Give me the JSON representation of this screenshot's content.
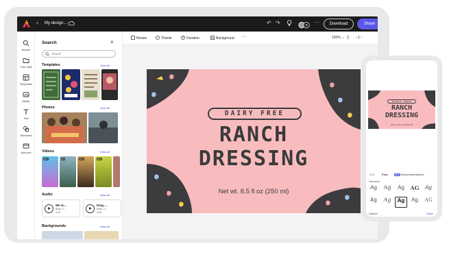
{
  "topbar": {
    "doc_title": "My design...",
    "download_label": "Download",
    "share_label": "Share"
  },
  "rail": [
    {
      "label": "Search",
      "icon": "search-icon"
    },
    {
      "label": "Your stuff",
      "icon": "folder-icon"
    },
    {
      "label": "Templates",
      "icon": "templates-icon"
    },
    {
      "label": "Media",
      "icon": "media-icon"
    },
    {
      "label": "Text",
      "icon": "text-icon"
    },
    {
      "label": "Elements",
      "icon": "elements-icon"
    },
    {
      "label": "Add-ons",
      "icon": "add-ons-icon"
    }
  ],
  "panel": {
    "title": "Search",
    "search_placeholder": "Search",
    "sections": {
      "templates": "Templates",
      "photos": "Photos",
      "videos": "Videos",
      "audio": "Audio",
      "backgrounds": "Backgrounds"
    },
    "view_all": "View all",
    "videos": [
      {
        "duration": "24 s"
      },
      {
        "duration": "9 s"
      },
      {
        "duration": "14 s"
      },
      {
        "duration": "18 s"
      }
    ],
    "audio": [
      {
        "title": "We ar...",
        "artist": "Bose, C...",
        "duration": "4:20"
      },
      {
        "title": "King ...",
        "artist": "Earth, C...",
        "duration": "3:04"
      }
    ]
  },
  "toolbar": {
    "resize": "Resize",
    "theme": "Theme",
    "duration": "Duration",
    "background": "Background",
    "zoom": "100%",
    "page": "1"
  },
  "design": {
    "badge": "DAIRY FREE",
    "title_line1": "RANCH",
    "title_line2": "DRESSING",
    "subtitle": "Net wt. 8.5 fl oz (250 ml)",
    "bg_color": "#f8bcbf",
    "ink_color": "#3a3a3a"
  },
  "phone": {
    "tabs": {
      "edit": "Edit",
      "font": "Font",
      "new_badge": "NEW",
      "recommendations": "Recommendations"
    },
    "section_label": "Standards",
    "fonts": [
      {
        "glyph": "Ag"
      },
      {
        "glyph": "Ag"
      },
      {
        "glyph": "Ag"
      },
      {
        "glyph": "AG"
      },
      {
        "glyph": "Ag"
      },
      {
        "glyph": "Ag"
      },
      {
        "glyph": "Ag"
      },
      {
        "glyph": "Ag"
      },
      {
        "glyph": "Ag"
      },
      {
        "glyph": "AG"
      }
    ],
    "cancel": "Cancel",
    "done": "Done"
  },
  "colors": {
    "accent": "#5a58e6",
    "topbar": "#1b1b1b"
  }
}
